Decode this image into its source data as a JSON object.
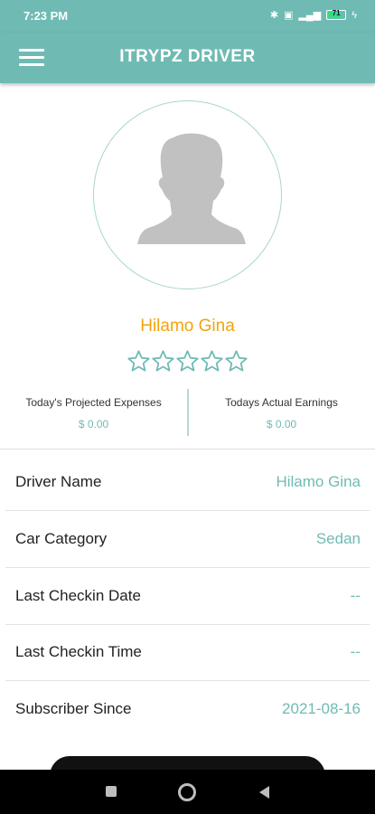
{
  "status_bar": {
    "time": "7:23 PM",
    "battery_level": "71"
  },
  "app_bar": {
    "title": "ITRYPZ DRIVER",
    "menu_icon": "hamburger-menu-icon"
  },
  "profile": {
    "avatar_icon": "user-silhouette-icon",
    "name": "Hilamo Gina",
    "rating": 0,
    "rating_max": 5
  },
  "stats": {
    "projected_expenses_label": "Today's Projected Expenses",
    "projected_expenses_value": "$ 0.00",
    "actual_earnings_label": "Todays Actual Earnings",
    "actual_earnings_value": "$ 0.00"
  },
  "details": [
    {
      "label": "Driver Name",
      "value": "Hilamo Gina"
    },
    {
      "label": "Car Category",
      "value": "Sedan"
    },
    {
      "label": "Last Checkin Date",
      "value": "--"
    },
    {
      "label": "Last Checkin Time",
      "value": "--"
    },
    {
      "label": "Subscriber Since",
      "value": "2021-08-16"
    }
  ],
  "colors": {
    "primary": "#6fbbb3",
    "name_accent": "#f2a40a"
  },
  "nav_bar": {
    "recents_icon": "square-recents-icon",
    "home_icon": "circle-home-icon",
    "back_icon": "triangle-back-icon"
  }
}
